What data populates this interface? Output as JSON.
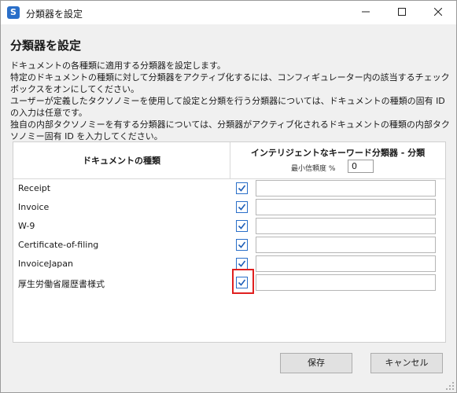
{
  "window": {
    "title": "分類器を設定",
    "app_icon_glyph": "S"
  },
  "heading": "分類器を設定",
  "description": [
    "ドキュメントの各種類に適用する分類器を設定します。",
    "特定のドキュメントの種類に対して分類器をアクティブ化するには、コンフィギュレーター内の該当するチェックボックスをオンにしてください。",
    "ユーザーが定義したタクソノミーを使用して設定と分類を行う分類器については、ドキュメントの種類の固有 ID の入力は任意です。",
    "独自の内部タクソノミーを有する分類器については、分類器がアクティブ化されるドキュメントの種類の内部タクソノミー固有 ID を入力してください。"
  ],
  "table": {
    "col1_header": "ドキュメントの種類",
    "col2_header": "インテリジェントなキーワード分類器 - 分類",
    "min_freq_label": "最小信頼度 %",
    "min_freq_value": "0",
    "rows": [
      {
        "name": "Receipt",
        "checked": true,
        "id_value": ""
      },
      {
        "name": "Invoice",
        "checked": true,
        "id_value": ""
      },
      {
        "name": "W-9",
        "checked": true,
        "id_value": ""
      },
      {
        "name": "Certificate-of-filing",
        "checked": true,
        "id_value": ""
      },
      {
        "name": "InvoiceJapan",
        "checked": true,
        "id_value": ""
      },
      {
        "name": "厚生労働省履歴書様式",
        "checked": true,
        "id_value": ""
      }
    ]
  },
  "buttons": {
    "save": "保存",
    "cancel": "キャンセル"
  },
  "colors": {
    "accent": "#2a6fc9",
    "highlight": "#e02020"
  }
}
